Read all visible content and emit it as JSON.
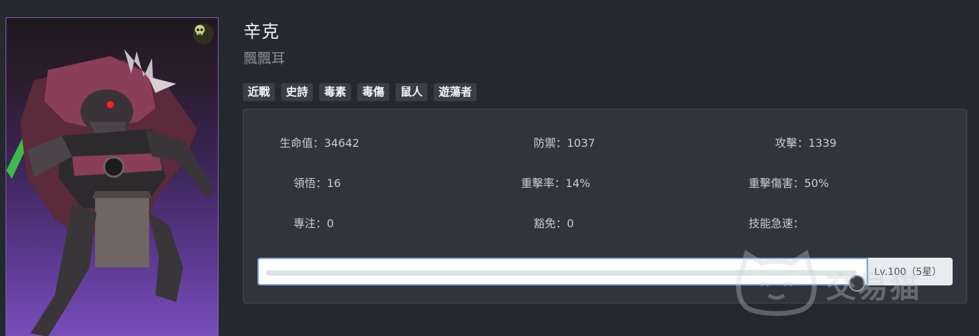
{
  "hero": {
    "name": "辛克",
    "alias": "飄飄耳",
    "tags": [
      "近戰",
      "史詩",
      "毒素",
      "毒傷",
      "鼠人",
      "遊蕩者"
    ]
  },
  "stats": {
    "hp": "生命值：34642",
    "defense": "防禦：1037",
    "attack": "攻擊：1339",
    "insight": "領悟：16",
    "crit_rate": "重擊率：14%",
    "crit_damage": "重擊傷害：50%",
    "focus": "專注：0",
    "immunity": "豁免：0",
    "skill_haste": "技能急速："
  },
  "level": {
    "label": "Lv.100（5星）",
    "slider_fraction": 1.0
  },
  "watermark": {
    "text": "交易猫",
    "icon": "cat-face-icon"
  },
  "icons": {
    "badge": "skull-icon"
  },
  "colors": {
    "background": "#25282d",
    "panel": "#30343c",
    "tag": "#3a3e45",
    "portrait_border": "#7a62c2",
    "skull_badge": "#c8d28a"
  }
}
